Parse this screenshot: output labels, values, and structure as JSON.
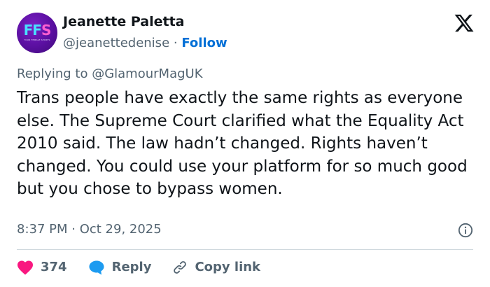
{
  "author": {
    "display_name": "Jeanette Paletta",
    "handle": "@jeanettedenise",
    "separator": "·",
    "follow_label": "Follow",
    "avatar": {
      "initials_main": "FF",
      "initials_accent": "S",
      "sub_text": "YOUR FEMALE SPORTS",
      "colors": {
        "bg": "#5a0fa0",
        "text": "#49e0ff",
        "accent": "#ff5fd0"
      }
    }
  },
  "replying_to": "Replying to @GlamourMagUK",
  "tweet_text": "Trans people have exactly the same rights as everyone else. The Supreme Court clarified what the Equality Act 2010 said. The law hadn’t changed. Rights haven’t changed. You could use your platform for so much good but you chose to bypass women.",
  "timestamp": "8:37 PM · Oct 29, 2025",
  "actions": {
    "like_count": "374",
    "reply_label": "Reply",
    "copy_label": "Copy link"
  },
  "icons": {
    "brand": "x-logo-icon",
    "info": "info-icon",
    "like": "heart-icon",
    "reply": "speech-bubble-icon",
    "copy": "link-icon"
  },
  "colors": {
    "like": "#f91880",
    "reply": "#1d9bf0",
    "follow": "#006fd6",
    "muted": "#536471",
    "text": "#0f1419"
  }
}
